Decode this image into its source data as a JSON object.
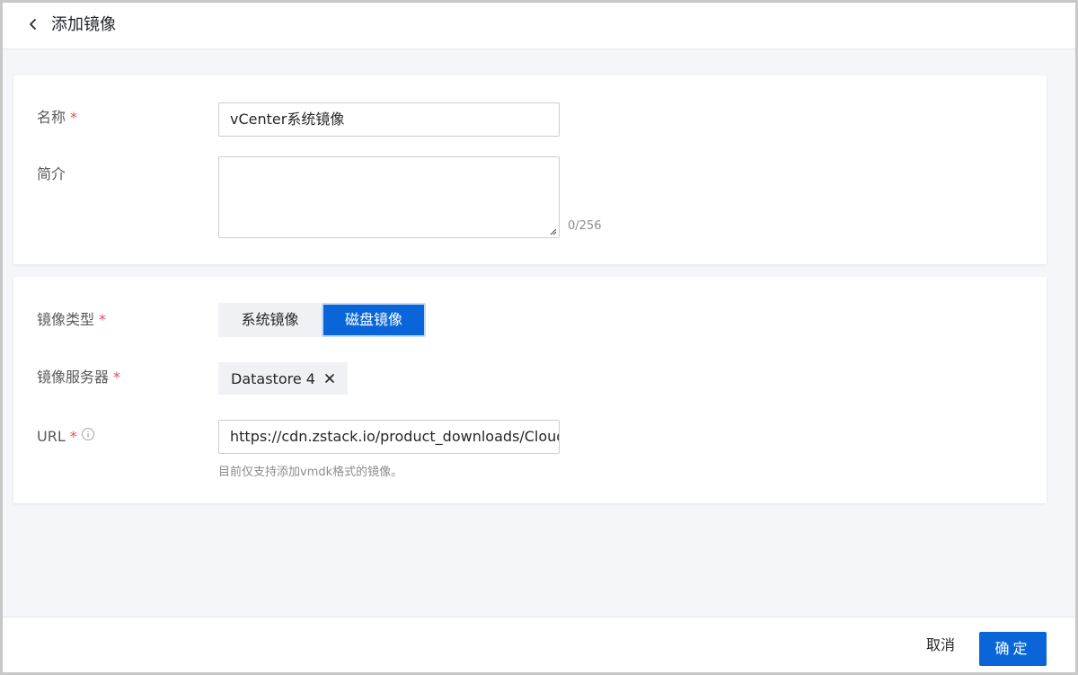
{
  "header": {
    "title": "添加镜像"
  },
  "form": {
    "name": {
      "label": "名称",
      "required": "*",
      "value": "vCenter系统镜像"
    },
    "description": {
      "label": "简介",
      "value": "",
      "counter": "0/256"
    },
    "image_type": {
      "label": "镜像类型",
      "required": "*",
      "options": [
        "系统镜像",
        "磁盘镜像"
      ],
      "selected": "磁盘镜像"
    },
    "image_server": {
      "label": "镜像服务器",
      "required": "*",
      "tag": "Datastore 4"
    },
    "url": {
      "label": "URL",
      "required": "*",
      "value": "https://cdn.zstack.io/product_downloads/Cloud_",
      "hint": "目前仅支持添加vmdk格式的镜像。"
    }
  },
  "footer": {
    "cancel_label": "取消",
    "ok_label": "确定"
  },
  "colors": {
    "primary": "#0a66d8",
    "required": "#e34d59"
  }
}
